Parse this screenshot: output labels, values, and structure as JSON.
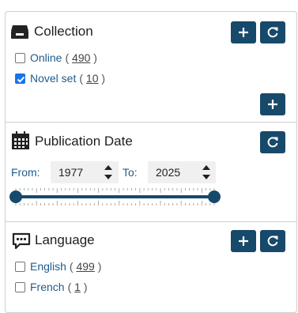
{
  "collection": {
    "title": "Collection",
    "icon": "archive-box-icon",
    "facets": [
      {
        "label": "Online",
        "count": "490",
        "checked": false
      },
      {
        "label": "Novel set",
        "count": "10",
        "checked": true
      }
    ]
  },
  "publication_date": {
    "title": "Publication Date",
    "icon": "calendar-icon",
    "from_label": "From:",
    "from_value": "1977",
    "to_label": "To:",
    "to_value": "2025"
  },
  "language": {
    "title": "Language",
    "icon": "speech-bubble-icon",
    "facets": [
      {
        "label": "English",
        "count": "499",
        "checked": false
      },
      {
        "label": "French",
        "count": "1",
        "checked": false
      }
    ]
  },
  "colors": {
    "button": "#17496b",
    "link": "#1f5b8c",
    "checkbox_checked": "#1a73e8"
  }
}
